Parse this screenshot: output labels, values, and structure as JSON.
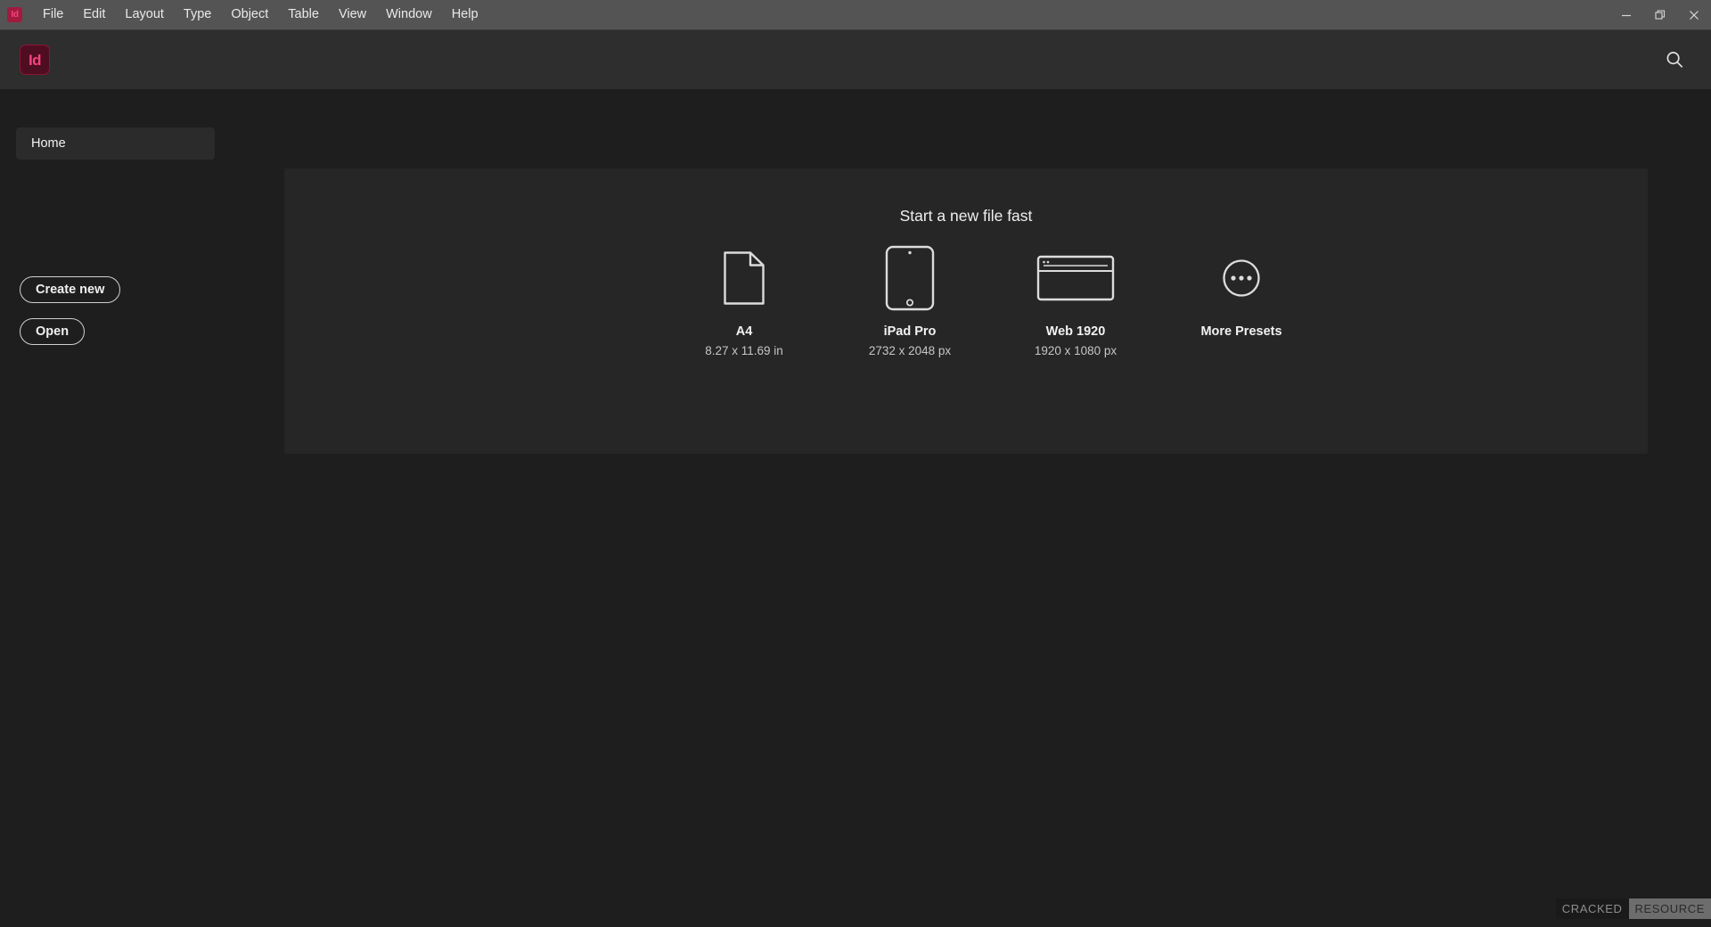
{
  "app": {
    "name": "Adobe InDesign",
    "logo_text": "Id",
    "logo_color": "#f7417f",
    "logo_bg": "#4f0d22"
  },
  "menubar": {
    "items": [
      {
        "label": "File"
      },
      {
        "label": "Edit"
      },
      {
        "label": "Layout"
      },
      {
        "label": "Type"
      },
      {
        "label": "Object"
      },
      {
        "label": "Table"
      },
      {
        "label": "View"
      },
      {
        "label": "Window"
      },
      {
        "label": "Help"
      }
    ],
    "window_controls": [
      {
        "name": "minimize",
        "glyph": "–"
      },
      {
        "name": "restore",
        "glyph": "❐"
      },
      {
        "name": "close",
        "glyph": "✕"
      }
    ]
  },
  "header": {
    "search_icon": "search-icon"
  },
  "sidebar": {
    "tabs": [
      {
        "label": "Home",
        "active": true
      }
    ],
    "buttons": [
      {
        "label": "Create new"
      },
      {
        "label": "Open"
      }
    ]
  },
  "main": {
    "title": "Start a new file fast",
    "presets": [
      {
        "name": "A4",
        "size": "8.27 x 11.69 in",
        "icon": "document-page-icon"
      },
      {
        "name": "iPad Pro",
        "size": "2732 x 2048 px",
        "icon": "tablet-icon"
      },
      {
        "name": "Web 1920",
        "size": "1920 x 1080 px",
        "icon": "browser-window-icon"
      },
      {
        "name": "More Presets",
        "size": "",
        "icon": "ellipsis-circle-icon"
      }
    ]
  },
  "watermark": {
    "part1": "CRACKED",
    "part2": "RESOURCE"
  }
}
